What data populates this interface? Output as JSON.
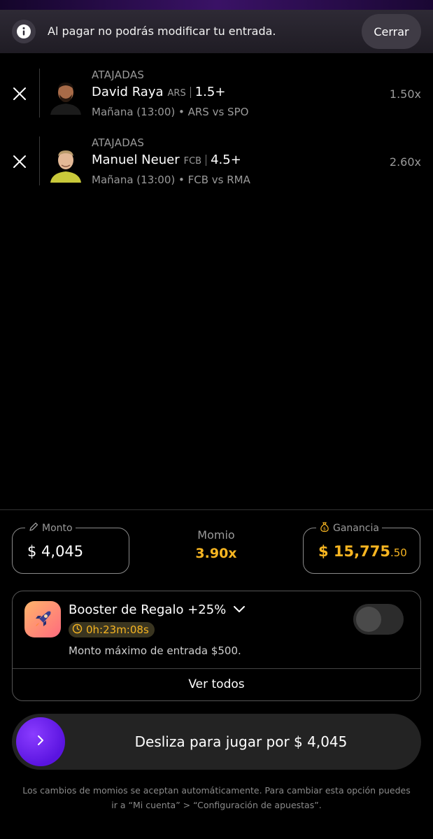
{
  "banner": {
    "message": "Al pagar no podrás modificar tu entrada.",
    "close_label": "Cerrar"
  },
  "legs": [
    {
      "stat": "ATAJADAS",
      "player": "David Raya",
      "team": "ARS",
      "line": "1.5+",
      "match": "Mañana (13:00) • ARS  vs SPO",
      "multiplier": "1.50x"
    },
    {
      "stat": "ATAJADAS",
      "player": "Manuel Neuer",
      "team": "FCB",
      "line": "4.5+",
      "match": "Mañana (13:00) • FCB  vs RMA",
      "multiplier": "2.60x"
    }
  ],
  "amount": {
    "label": "Monto",
    "value": "$ 4,045"
  },
  "odds": {
    "label": "Momio",
    "value": "3.90x"
  },
  "winnings": {
    "label": "Ganancia",
    "value_main": "$ 15,775",
    "value_cents": ".50"
  },
  "booster": {
    "title": "Booster de Regalo +25%",
    "timer": "0h:23m:08s",
    "note": "Monto máximo de entrada $500.",
    "see_all": "Ver todos",
    "enabled": false
  },
  "slider": {
    "label": "Desliza para jugar por $ 4,045"
  },
  "footer": {
    "line1": "Los cambios de momios se aceptan automáticamente. Para cambiar esta opción puedes",
    "line2": "ir a “Mi cuenta” > “Configuración de apuestas”."
  },
  "colors": {
    "accent_gold": "#f7b521",
    "slider_purple": "#5a14e0",
    "background": "#000000"
  },
  "icons": {
    "info": "info-icon",
    "remove": "close-icon",
    "pencil": "pencil-icon",
    "money": "money-bag-icon",
    "rocket": "rocket-icon",
    "chevron": "chevron-down-icon",
    "clock": "clock-icon",
    "arrow": "chevron-right-icon"
  }
}
